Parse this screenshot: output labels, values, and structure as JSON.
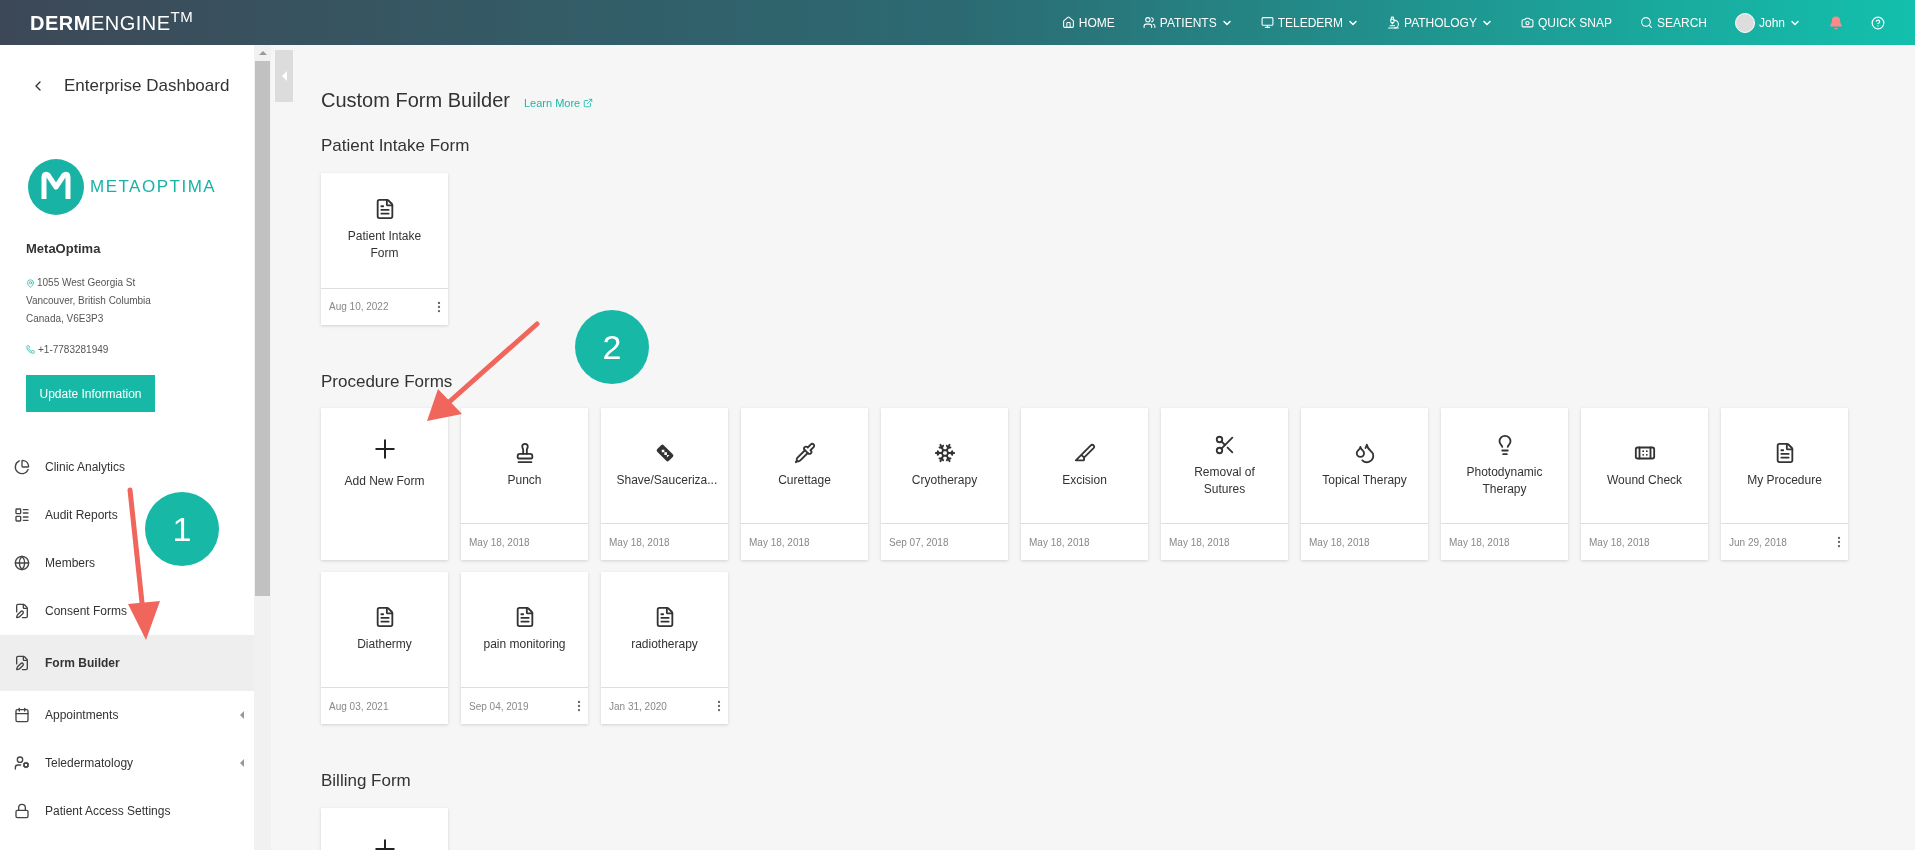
{
  "topbar": {
    "logo": "**DERM**ENGINE$^{TM}$",
    "nav": [
      {
        "label": "HOME",
        "dropdown": false
      },
      {
        "label": "PATIENTS",
        "dropdown": true
      },
      {
        "label": "TELEDERM",
        "dropdown": true
      },
      {
        "label": "PATHOLOGY",
        "dropdown": true
      },
      {
        "label": "QUICK SNAP",
        "dropdown": false
      },
      {
        "label": "SEARCH",
        "dropdown": false
      }
    ],
    "user": {
      "name": "John",
      "dropdown": true
    }
  },
  "sidebar": {
    "back_label": "Enterprise Dashboard",
    "logo_text": "METAOPTIMA",
    "org_name": "MetaOptima",
    "address": [
      "1055 West Georgia St",
      "Vancouver, British Columbia",
      "Canada, V6E3P3"
    ],
    "phone": "+1-7783281949",
    "update_button": "Update Information",
    "items": [
      {
        "label": "Clinic Analytics",
        "selected": false,
        "expandable": false
      },
      {
        "label": "Audit Reports",
        "selected": false,
        "expandable": false
      },
      {
        "label": "Members",
        "selected": false,
        "expandable": false
      },
      {
        "label": "Consent Forms",
        "selected": false,
        "expandable": false
      },
      {
        "label": "Form Builder",
        "selected": true,
        "expandable": false
      },
      {
        "label": "Appointments",
        "selected": false,
        "expandable": true
      },
      {
        "label": "Teledermatology",
        "selected": false,
        "expandable": true
      },
      {
        "label": "Patient Access Settings",
        "selected": false,
        "expandable": false
      }
    ]
  },
  "main": {
    "title": "Custom Form Builder",
    "learn_more": "Learn More",
    "sections": [
      {
        "title": "Patient Intake Form",
        "cards": [
          {
            "kind": "form",
            "label": "Patient Intake Form",
            "date": "Aug 10, 2022",
            "menu": true
          }
        ]
      },
      {
        "title": "Procedure Forms",
        "cards": [
          {
            "kind": "add",
            "label": "Add New Form"
          },
          {
            "kind": "form",
            "label": "Punch",
            "date": "May 18, 2018",
            "menu": false
          },
          {
            "kind": "form",
            "label": "Shave/Sauceriza...",
            "date": "May 18, 2018",
            "menu": false
          },
          {
            "kind": "form",
            "label": "Curettage",
            "date": "May 18, 2018",
            "menu": false
          },
          {
            "kind": "form",
            "label": "Cryotherapy",
            "date": "Sep 07, 2018",
            "menu": false
          },
          {
            "kind": "form",
            "label": "Excision",
            "date": "May 18, 2018",
            "menu": false
          },
          {
            "kind": "form",
            "label": "Removal of Sutures",
            "date": "May 18, 2018",
            "menu": false
          },
          {
            "kind": "form",
            "label": "Topical Therapy",
            "date": "May 18, 2018",
            "menu": false
          },
          {
            "kind": "form",
            "label": "Photodynamic Therapy",
            "date": "May 18, 2018",
            "menu": false
          },
          {
            "kind": "form",
            "label": "Wound Check",
            "date": "May 18, 2018",
            "menu": false
          },
          {
            "kind": "form",
            "label": "My Procedure",
            "date": "Jun 29, 2018",
            "menu": true
          },
          {
            "kind": "form",
            "label": "Diathermy",
            "date": "Aug 03, 2021",
            "menu": false
          },
          {
            "kind": "form",
            "label": "pain monitoring",
            "date": "Sep 04, 2019",
            "menu": true
          },
          {
            "kind": "form",
            "label": "radiotherapy",
            "date": "Jan 31, 2020",
            "menu": true
          }
        ]
      },
      {
        "title": "Billing Form",
        "cards": [
          {
            "kind": "add"
          }
        ]
      }
    ]
  },
  "annotations": [
    {
      "label": "1"
    },
    {
      "label": "2"
    }
  ]
}
